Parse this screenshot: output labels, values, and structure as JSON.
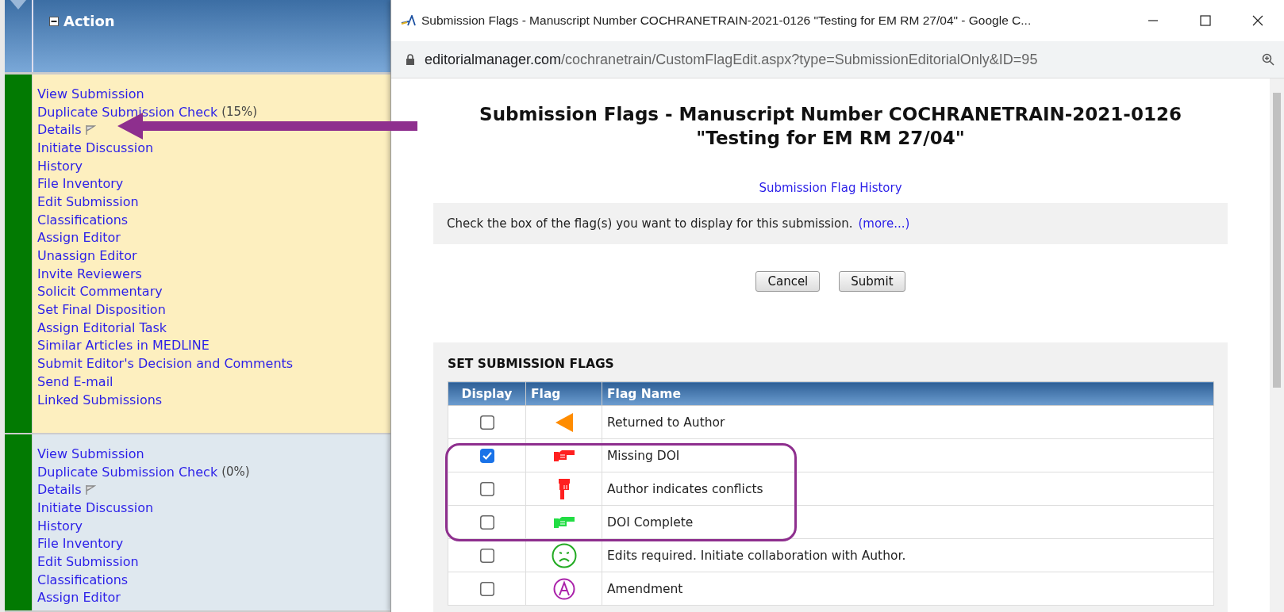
{
  "sidebar": {
    "header": "Action",
    "groups": [
      {
        "selected": true,
        "items": [
          {
            "kind": "link",
            "label": "View Submission"
          },
          {
            "kind": "link",
            "label": "Duplicate Submission Check",
            "note": "(15%)"
          },
          {
            "kind": "flag",
            "label": "Details"
          },
          {
            "kind": "link",
            "label": "Initiate Discussion"
          },
          {
            "kind": "link",
            "label": "History"
          },
          {
            "kind": "link",
            "label": "File Inventory"
          },
          {
            "kind": "link",
            "label": "Edit Submission"
          },
          {
            "kind": "link",
            "label": "Classifications"
          },
          {
            "kind": "link",
            "label": "Assign Editor"
          },
          {
            "kind": "link",
            "label": "Unassign Editor"
          },
          {
            "kind": "link",
            "label": "Invite Reviewers"
          },
          {
            "kind": "link",
            "label": "Solicit Commentary"
          },
          {
            "kind": "link",
            "label": "Set Final Disposition"
          },
          {
            "kind": "link",
            "label": "Assign Editorial Task"
          },
          {
            "kind": "link",
            "label": "Similar Articles in MEDLINE"
          },
          {
            "kind": "link",
            "label": "Submit Editor's Decision and Comments"
          },
          {
            "kind": "link",
            "label": "Send E-mail"
          },
          {
            "kind": "link",
            "label": "Linked Submissions"
          }
        ]
      },
      {
        "selected": false,
        "items": [
          {
            "kind": "link",
            "label": "View Submission"
          },
          {
            "kind": "link",
            "label": "Duplicate Submission Check",
            "note": "(0%)"
          },
          {
            "kind": "flag",
            "label": "Details"
          },
          {
            "kind": "link",
            "label": "Initiate Discussion"
          },
          {
            "kind": "link",
            "label": "History"
          },
          {
            "kind": "link",
            "label": "File Inventory"
          },
          {
            "kind": "link",
            "label": "Edit Submission"
          },
          {
            "kind": "link",
            "label": "Classifications"
          },
          {
            "kind": "link",
            "label": "Assign Editor"
          }
        ]
      }
    ]
  },
  "popup": {
    "title": "Submission Flags - Manuscript Number COCHRANETRAIN-2021-0126 \"Testing for EM RM 27/04\" - Google C...",
    "url_host": "editorialmanager.com",
    "url_path": "/cochranetrain/CustomFlagEdit.aspx?type=SubmissionEditorialOnly&ID=95",
    "heading": "Submission Flags - Manuscript Number COCHRANETRAIN-2021-0126 \"Testing for EM RM 27/04\"",
    "history_link": "Submission Flag History",
    "info": {
      "text": "Check the box of the flag(s) you want to display for this submission.",
      "link": "(more...)"
    },
    "buttons": [
      "Cancel",
      "Submit"
    ],
    "section_title": "SET SUBMISSION FLAGS",
    "table": {
      "columns": [
        "Display",
        "Flag",
        "Flag Name"
      ],
      "rows": [
        {
          "checked": false,
          "kind": "triangle",
          "color": "#ff8c00",
          "name": "Returned to Author"
        },
        {
          "checked": true,
          "kind": "hand-right",
          "color": "#ff2020",
          "name": "Missing DOI"
        },
        {
          "checked": false,
          "kind": "hand-down",
          "color": "#ff2020",
          "name": "Author indicates conflicts"
        },
        {
          "checked": false,
          "kind": "hand-right",
          "color": "#22dd44",
          "name": "DOI Complete"
        },
        {
          "checked": false,
          "kind": "sad-face",
          "color": "#22aa22",
          "name": "Edits required. Initiate collaboration with Author."
        },
        {
          "checked": false,
          "kind": "circle-a",
          "color": "#aa22aa",
          "name": "Amendment"
        }
      ]
    }
  }
}
